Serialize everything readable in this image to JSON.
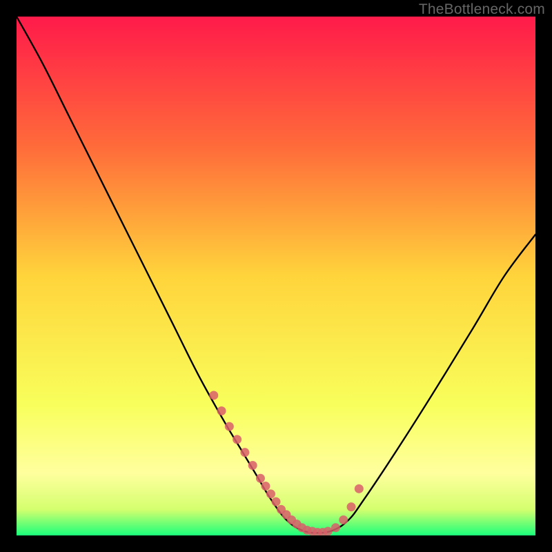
{
  "watermark": "TheBottleneck.com",
  "chart_data": {
    "type": "line",
    "title": "",
    "xlabel": "",
    "ylabel": "",
    "xlim": [
      0,
      100
    ],
    "ylim": [
      0,
      100
    ],
    "background_gradient": {
      "stops": [
        {
          "offset": 0,
          "color": "#ff1a4a"
        },
        {
          "offset": 25,
          "color": "#ff6b3a"
        },
        {
          "offset": 50,
          "color": "#ffd43b"
        },
        {
          "offset": 75,
          "color": "#f8ff5c"
        },
        {
          "offset": 88,
          "color": "#ffff9e"
        },
        {
          "offset": 95,
          "color": "#d4ff6e"
        },
        {
          "offset": 100,
          "color": "#1aff7a"
        }
      ]
    },
    "series": [
      {
        "name": "bottleneck-curve",
        "x": [
          0,
          5,
          10,
          15,
          20,
          25,
          30,
          35,
          40,
          43,
          46,
          49,
          52,
          55,
          58,
          61,
          64,
          67,
          73,
          80,
          88,
          94,
          100
        ],
        "values": [
          100,
          91,
          81,
          71,
          61,
          51,
          41,
          31,
          22,
          17,
          12,
          7,
          3,
          1,
          0.5,
          1,
          3,
          7,
          16,
          27,
          40,
          50,
          58
        ]
      }
    ],
    "marker_points": {
      "name": "highlight-points",
      "color": "#d95f6a",
      "x": [
        38,
        39.5,
        41,
        42.5,
        44,
        45.5,
        47,
        48,
        49,
        50,
        51,
        52,
        53,
        54,
        55,
        56,
        57,
        58,
        59,
        60,
        61.5,
        63,
        64.5,
        66
      ],
      "y": [
        27,
        24,
        21,
        18.5,
        16,
        13.5,
        11,
        9.5,
        8,
        6.5,
        5,
        4,
        3,
        2.2,
        1.5,
        1,
        0.8,
        0.6,
        0.6,
        0.8,
        1.5,
        3,
        5.5,
        9
      ]
    }
  }
}
